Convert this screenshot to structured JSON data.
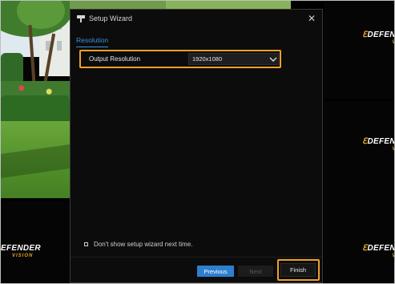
{
  "dialog": {
    "title": "Setup Wizard",
    "close_glyph": "✕",
    "tab_label": "Resolution",
    "output_resolution_label": "Output Resolution",
    "output_resolution_value": "1920x1080",
    "dont_show_label": "Don't show setup wizard next time.",
    "dont_show_checked": false,
    "buttons": {
      "previous": "Previous",
      "next": "Next",
      "finish": "Finish"
    }
  },
  "tiles": {
    "logo_text": "DEFENDER",
    "logo_sub": "VISION",
    "logo_partial": "EFENDER",
    "logo_right": "DEFENDE",
    "logo_right_cut": "DEFEND"
  },
  "icons": {
    "wizard": "wand-icon",
    "close": "close-icon",
    "dropdown": "chevron-down-icon",
    "checkbox": "checkbox-icon"
  },
  "colors": {
    "accent": "#2d7fd0",
    "highlight": "#f0a028",
    "tab": "#3a8fe0",
    "logo_accent": "#e3a520",
    "dialog_bg": "#0c0c0c"
  }
}
